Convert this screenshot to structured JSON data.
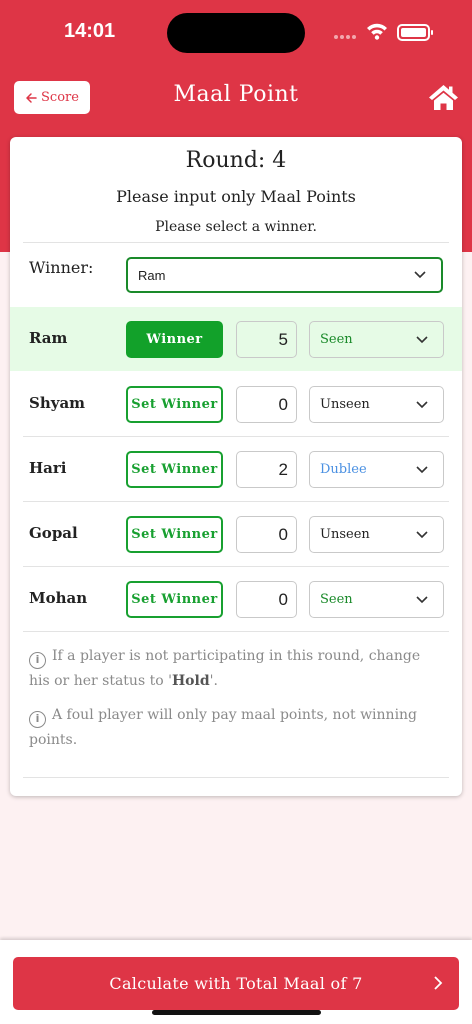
{
  "status_bar": {
    "time": "14:01"
  },
  "header": {
    "back_label": "Score",
    "title": "Maal Point"
  },
  "round": {
    "title": "Round: 4",
    "instruction_primary": "Please input only Maal Points",
    "instruction_secondary": "Please select a winner."
  },
  "winner": {
    "label": "Winner:",
    "selected": "Ram"
  },
  "players": [
    {
      "name": "Ram",
      "button": "Winner",
      "is_winner": true,
      "points": "5",
      "status": "Seen",
      "status_color": "#1a8a2a"
    },
    {
      "name": "Shyam",
      "button": "Set Winner",
      "is_winner": false,
      "points": "0",
      "status": "Unseen",
      "status_color": "#222222"
    },
    {
      "name": "Hari",
      "button": "Set Winner",
      "is_winner": false,
      "points": "2",
      "status": "Dublee",
      "status_color": "#4a90e2"
    },
    {
      "name": "Gopal",
      "button": "Set Winner",
      "is_winner": false,
      "points": "0",
      "status": "Unseen",
      "status_color": "#222222"
    },
    {
      "name": "Mohan",
      "button": "Set Winner",
      "is_winner": false,
      "points": "0",
      "status": "Seen",
      "status_color": "#1a8a2a"
    }
  ],
  "notes": {
    "hold_before": "If a player is not participating in this round, change his or her status to '",
    "hold_bold": "Hold",
    "hold_after": "'.",
    "foul": "A foul player will only pay maal points, not winning points."
  },
  "footer": {
    "calculate_label": "Calculate with Total Maal of 7"
  },
  "colors": {
    "primary": "#de3546",
    "success": "#12a12a",
    "winner_row_bg": "#e6fbe6"
  },
  "icons": {
    "back": "arrow-left-icon",
    "home": "home-icon",
    "info": "info-icon",
    "chevron": "chevron-down-icon",
    "next": "chevron-right-icon"
  }
}
